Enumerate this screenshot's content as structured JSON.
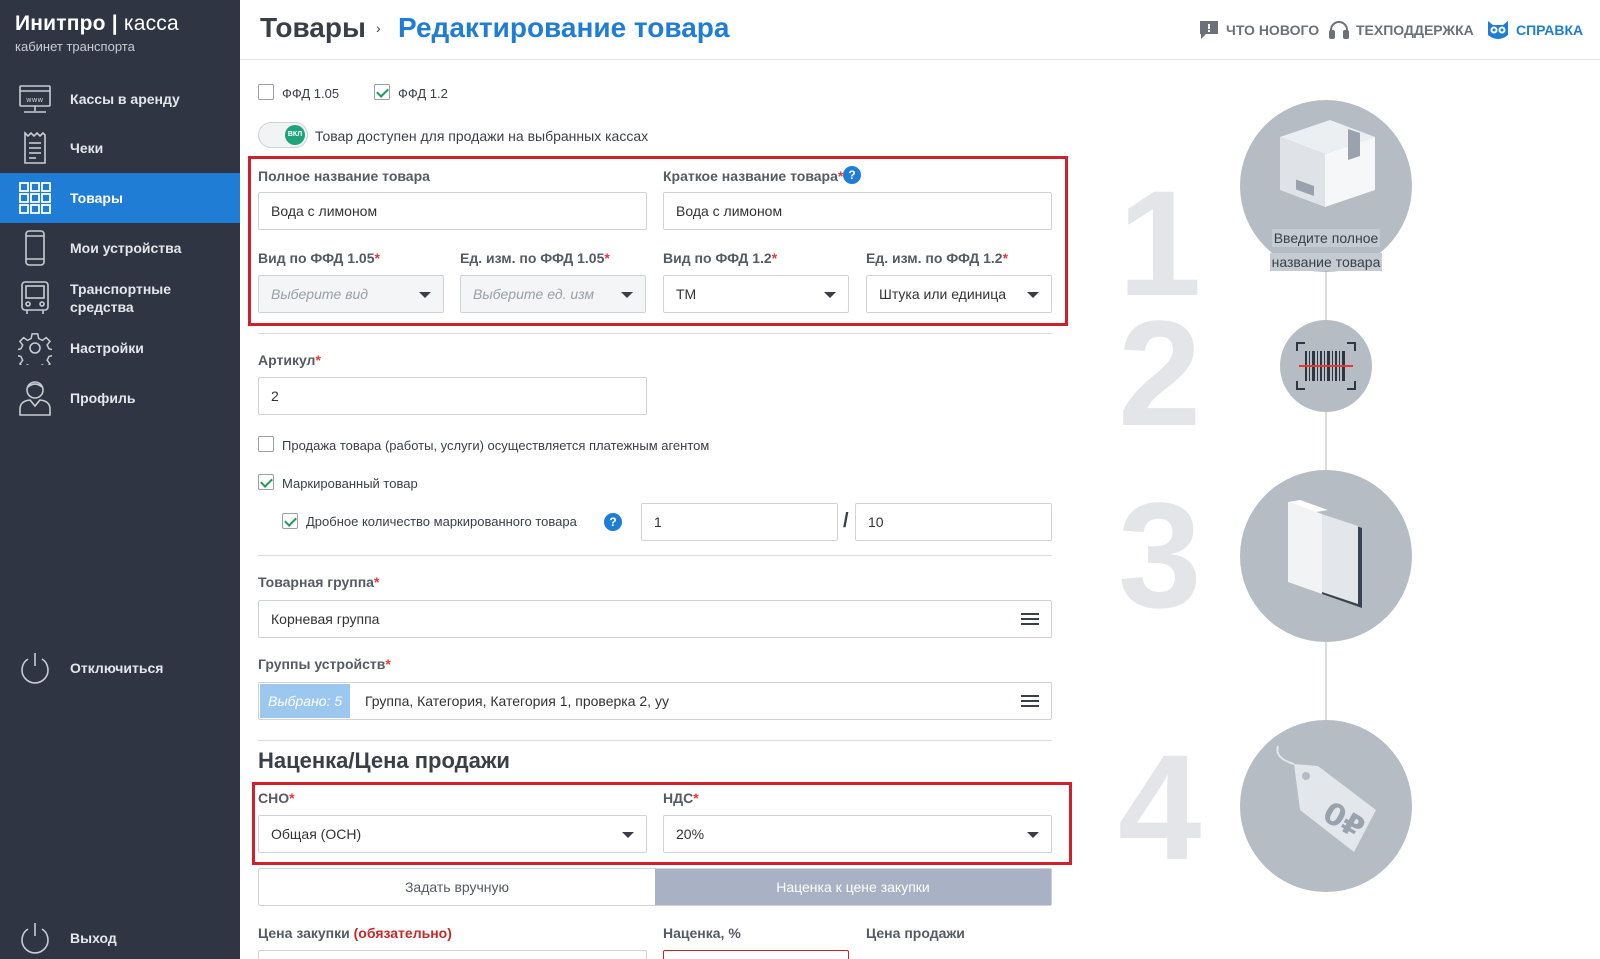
{
  "brand": {
    "name": "Инитпро",
    "product": "касса",
    "subtitle": "кабинет транспорта"
  },
  "sidebar": {
    "items": [
      {
        "label": "Кассы в аренду",
        "icon": "www-monitor-icon"
      },
      {
        "label": "Чеки",
        "icon": "receipt-icon"
      },
      {
        "label": "Товары",
        "icon": "grid-icon",
        "active": true
      },
      {
        "label": "Мои устройства",
        "icon": "phone-icon"
      },
      {
        "label": "Транспортные средства",
        "icon": "bus-icon"
      },
      {
        "label": "Настройки",
        "icon": "gear-icon"
      },
      {
        "label": "Профиль",
        "icon": "user-icon"
      }
    ],
    "disconnect": "Отключиться",
    "logout": "Выход"
  },
  "header": {
    "root": "Товары",
    "separator": "›",
    "current": "Редактирование товара",
    "links": {
      "whats_new": "ЧТО НОВОГО",
      "support": "ТЕХПОДДЕРЖКА",
      "help": "СПРАВКА"
    }
  },
  "form": {
    "ffd105_label": "ФФД 1.05",
    "ffd12_label": "ФФД 1.2",
    "toggle_knob": "ВКЛ",
    "toggle_label": "Товар доступен для продажи на выбранных кассах",
    "full_name_label": "Полное название товара",
    "full_name_value": "Вода с лимоном",
    "short_name_label": "Краткое название товара",
    "short_name_value": "Вода с лимоном",
    "req": "*",
    "help": "?",
    "kind105_label": "Вид по ФФД 1.05",
    "kind105_placeholder": "Выберите вид",
    "unit105_label": "Ед. изм. по ФФД 1.05",
    "unit105_placeholder": "Выберите ед. изм",
    "kind12_label": "Вид по ФФД 1.2",
    "kind12_value": "ТМ",
    "unit12_label": "Ед. изм. по ФФД 1.2",
    "unit12_value": "Штука или единица",
    "article_label": "Артикул",
    "article_value": "2",
    "agent_label": "Продажа товара (работы, услуги) осуществляется платежным агентом",
    "marked_label": "Маркированный товар",
    "fraction_label": "Дробное количество маркированного товара",
    "fraction_num": "1",
    "fraction_sep": "/",
    "fraction_den": "10",
    "group_label": "Товарная группа",
    "group_value": "Корневая группа",
    "device_groups_label": "Группы устройств",
    "device_groups_badge": "Выбрано: 5",
    "device_groups_value": "Группа, Категория, Категория 1, проверка 2, уу",
    "markup_title": "Наценка/Цена продажи",
    "sno_label": "СНО",
    "sno_value": "Общая (ОСН)",
    "vat_label": "НДС",
    "vat_value": "20%",
    "seg_manual": "Задать вручную",
    "seg_markup": "Наценка к цене закупки",
    "purchase_label": "Цена закупки",
    "purchase_required": "(обязательно)",
    "markup_label": "Наценка, %",
    "sale_label": "Цена продажи"
  },
  "steps": {
    "numbers": [
      "1",
      "2",
      "3",
      "4"
    ],
    "caption_line1": "Введите полное",
    "caption_line2": "название товара"
  }
}
